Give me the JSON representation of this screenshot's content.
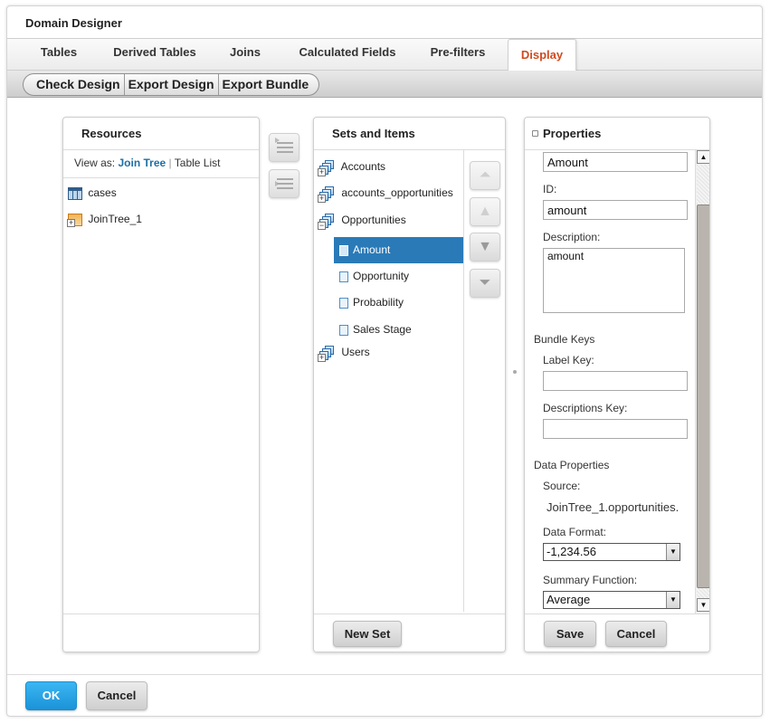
{
  "dialog": {
    "title": "Domain Designer"
  },
  "tabs": [
    {
      "label": "Tables"
    },
    {
      "label": "Derived Tables"
    },
    {
      "label": "Joins"
    },
    {
      "label": "Calculated Fields"
    },
    {
      "label": "Pre-filters"
    },
    {
      "label": "Display",
      "active": true
    }
  ],
  "toolbar": {
    "check_design": "Check Design",
    "export_design": "Export Design",
    "export_bundle": "Export Bundle"
  },
  "resources": {
    "title": "Resources",
    "view_as_label": "View as:",
    "view_join_tree": "Join Tree",
    "view_separator": "|",
    "view_table_list": "Table List",
    "items": [
      {
        "label": "cases",
        "icon": "table-icon"
      },
      {
        "label": "JoinTree_1",
        "icon": "join-tree-icon"
      }
    ]
  },
  "sets": {
    "title": "Sets and Items",
    "items": [
      {
        "label": "Accounts",
        "icon": "set-icon"
      },
      {
        "label": "accounts_opportunities",
        "icon": "set-icon"
      },
      {
        "label": "Opportunities",
        "icon": "set-icon"
      },
      {
        "label": "Users",
        "icon": "set-icon"
      }
    ],
    "children": [
      {
        "label": "Amount",
        "selected": true
      },
      {
        "label": "Opportunity"
      },
      {
        "label": "Probability"
      },
      {
        "label": "Sales Stage"
      }
    ],
    "new_set": "New Set"
  },
  "properties": {
    "title": "Properties",
    "label_value": "Amount",
    "id_label": "ID:",
    "id_value": "amount",
    "description_label": "Description:",
    "description_value": "amount",
    "bundle_keys_label": "Bundle Keys",
    "label_key_label": "Label Key:",
    "label_key_value": "",
    "descriptions_key_label": "Descriptions Key:",
    "descriptions_key_value": "",
    "data_properties_label": "Data Properties",
    "source_label": "Source:",
    "source_value": "JoinTree_1.opportunities.",
    "data_format_label": "Data Format:",
    "data_format_value": "-1,234.56",
    "summary_function_label": "Summary Function:",
    "summary_function_value": "Average",
    "save": "Save",
    "cancel": "Cancel"
  },
  "footer": {
    "ok": "OK",
    "cancel": "Cancel"
  },
  "colors": {
    "active_tab": "#d04a1e",
    "selection": "#2a7ab8",
    "ok_button": "#1a93d8",
    "link": "#1d6fa5"
  }
}
